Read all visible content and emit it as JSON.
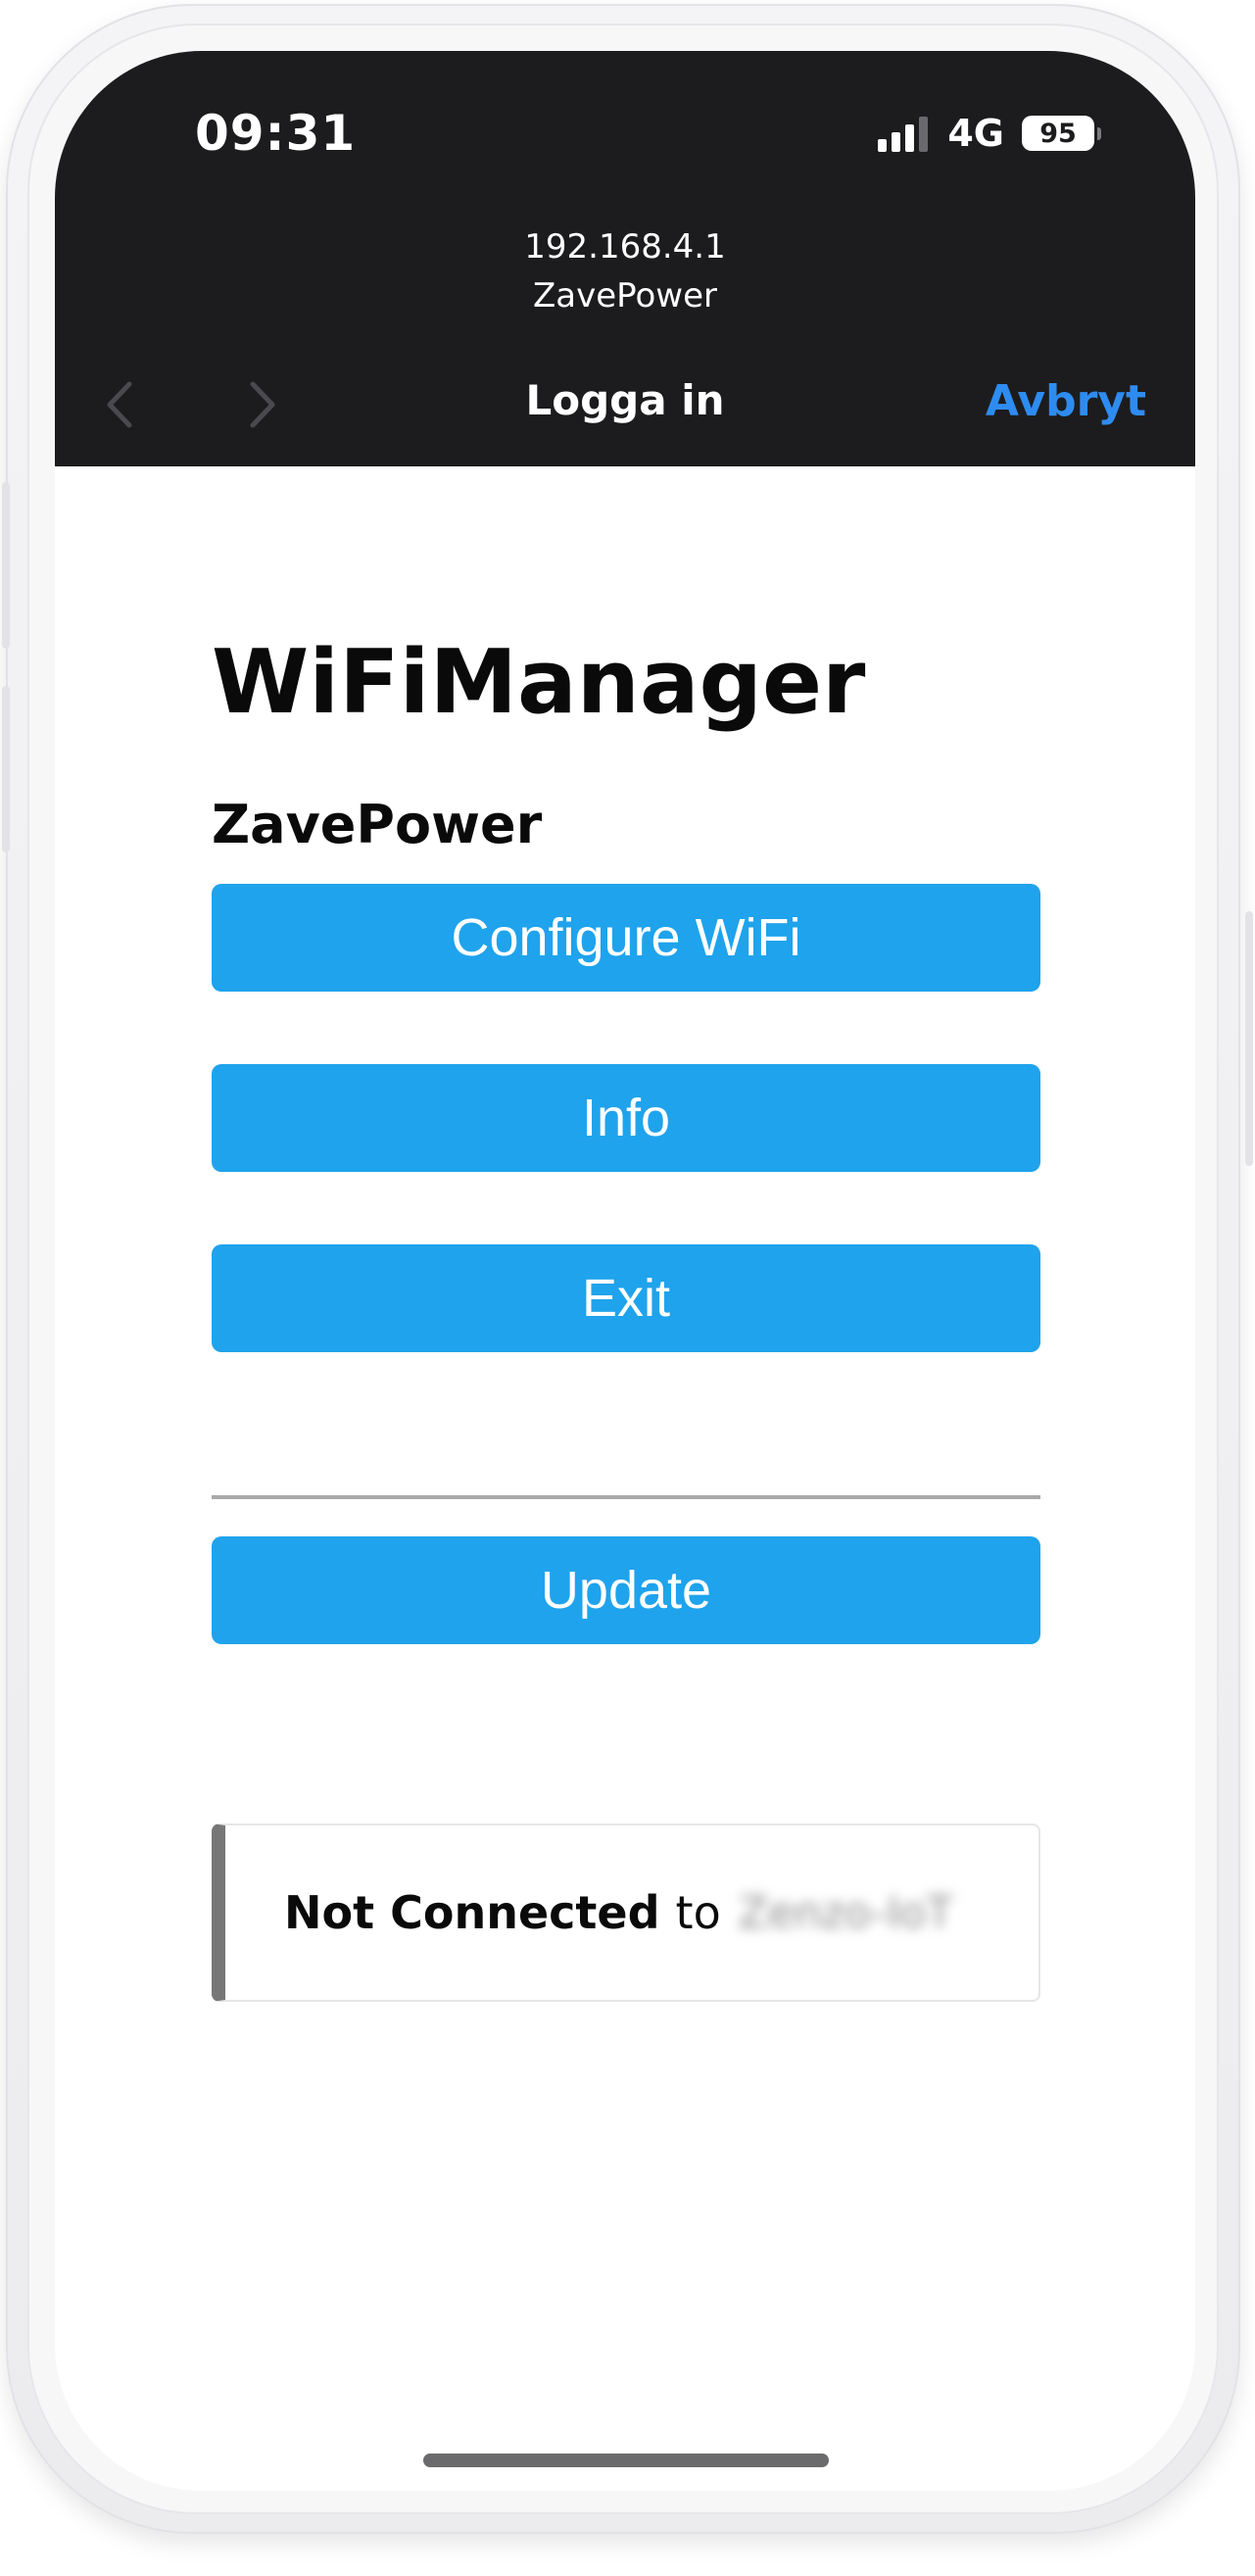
{
  "status_bar": {
    "time": "09:31",
    "network": "4G",
    "battery": "95"
  },
  "browser": {
    "address": "192.168.4.1",
    "page_name": "ZavePower",
    "title": "Logga in",
    "cancel_label": "Avbryt"
  },
  "page": {
    "heading": "WiFiManager",
    "subheading": "ZavePower",
    "buttons": {
      "configure": "Configure WiFi",
      "info": "Info",
      "exit": "Exit",
      "update": "Update"
    },
    "status": {
      "state": "Not Connected",
      "connector": "to",
      "ssid": "Zenzo-IoT"
    }
  },
  "colors": {
    "button_bg": "#1fa3ec",
    "button_text": "#ffffff",
    "header_bg": "#1c1c1e",
    "link": "#2e8cf0",
    "msg_border": "#777777"
  }
}
